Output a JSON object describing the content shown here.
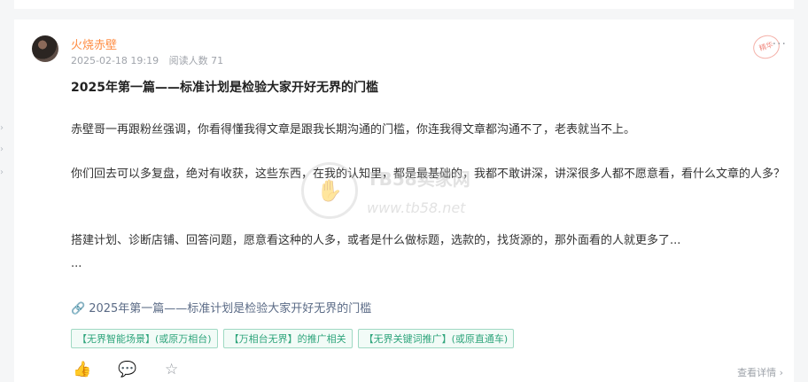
{
  "post": {
    "author": "火烧赤壁",
    "date": "2025-02-18 19:19",
    "reads": "阅读人数 71",
    "title": "2025年第一篇——标准计划是检验大家开好无界的门槛",
    "paragraphs": [
      "赤壁哥一再跟粉丝强调，你看得懂我得文章是跟我长期沟通的门槛，你连我得文章都沟通不了，老表就当不上。",
      "你们回去可以多复盘，绝对有收获，这些东西，在我的认知里，都是最基础的，我都不敢讲深，讲深很多人都不愿意看，看什么文章的人多？",
      "搭建计划、诊断店铺、回答问题，愿意看这种的人多，或者是什么做标题，选款的，找货源的，那外面看的人就更多了...",
      "..."
    ],
    "link_text": "2025年第一篇——标准计划是检验大家开好无界的门槛",
    "tags": [
      "【无界智能场景】(或原万相台)",
      "【万相台无界】的推广相关",
      "【无界关键词推广】(或原直通车)"
    ],
    "view_details": "查看详情 ›"
  },
  "watermark": {
    "name": "TB58卖家网",
    "url": "www.tb58.net"
  },
  "icons": {
    "more": "more-icon",
    "like": "thumbs-up-icon",
    "comment": "comment-icon",
    "favorite": "star-icon",
    "link": "link-icon"
  },
  "colors": {
    "author": "#ff8c42",
    "tag_border": "#9fd9c3",
    "tag_text": "#2fa57c",
    "link": "#5b6b86"
  }
}
